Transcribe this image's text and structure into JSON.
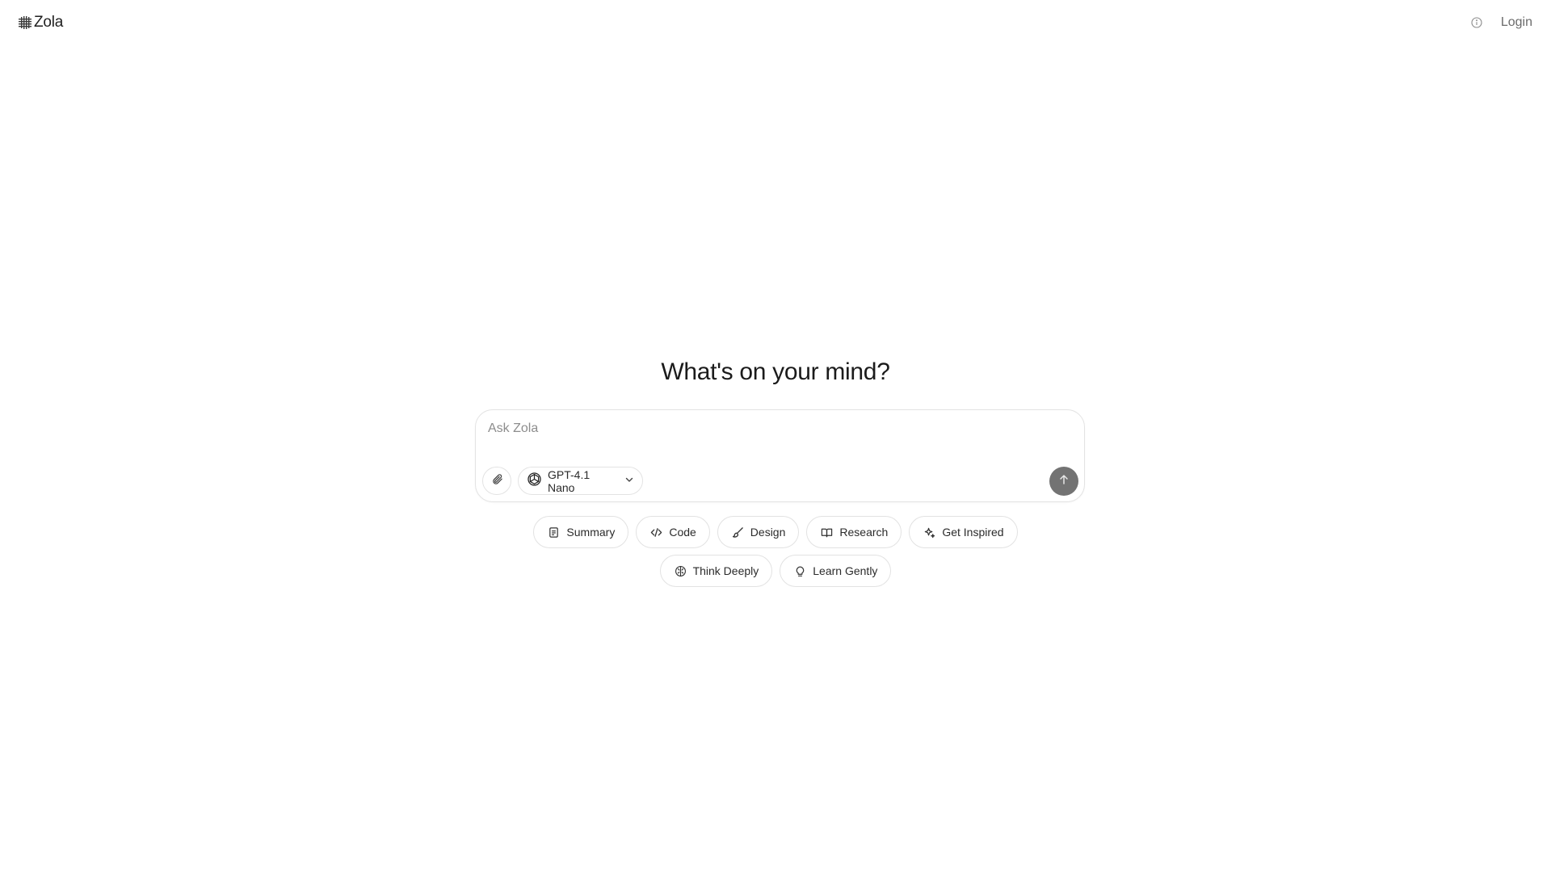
{
  "header": {
    "brand_name": "Zola",
    "brand_icon": "zola-logo-icon",
    "info_icon": "info-icon",
    "login_label": "Login"
  },
  "main": {
    "headline": "What's on your mind?",
    "composer": {
      "placeholder": "Ask Zola",
      "value": "",
      "attach_icon": "paperclip-icon",
      "model_icon": "openai-icon",
      "model_label": "GPT-4.1 Nano",
      "send_icon": "arrow-up-icon"
    },
    "suggestions": [
      {
        "label": "Summary",
        "icon": "document-icon"
      },
      {
        "label": "Code",
        "icon": "code-icon"
      },
      {
        "label": "Design",
        "icon": "brush-icon"
      },
      {
        "label": "Research",
        "icon": "book-icon"
      },
      {
        "label": "Get Inspired",
        "icon": "sparkle-icon"
      },
      {
        "label": "Think Deeply",
        "icon": "brain-icon"
      },
      {
        "label": "Learn Gently",
        "icon": "lightbulb-icon"
      }
    ]
  },
  "colors": {
    "background": "#ffffff",
    "border": "#e3e3e3",
    "send_button": "#737373",
    "muted_text": "#6b6b6b"
  }
}
